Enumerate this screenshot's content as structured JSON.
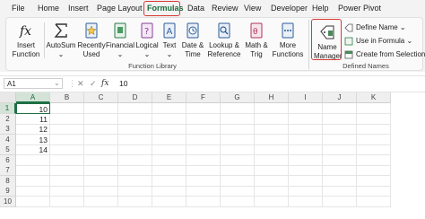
{
  "menu": {
    "tabs": [
      "File",
      "Home",
      "Insert",
      "Page Layout",
      "Formulas",
      "Data",
      "Review",
      "View",
      "Developer",
      "Help",
      "Power Pivot"
    ],
    "active_tab": "Formulas"
  },
  "ribbon": {
    "function_library": {
      "label": "Function Library",
      "buttons": [
        {
          "line1": "Insert",
          "line2": "Function",
          "icon": "fx-icon"
        },
        {
          "line1": "AutoSum",
          "line2": "",
          "icon": "sigma-icon"
        },
        {
          "line1": "Recently",
          "line2": "Used",
          "icon": "star-book-icon"
        },
        {
          "line1": "Financial",
          "line2": "",
          "icon": "financial-book-icon"
        },
        {
          "line1": "Logical",
          "line2": "",
          "icon": "question-book-icon"
        },
        {
          "line1": "Text",
          "line2": "",
          "icon": "text-book-icon"
        },
        {
          "line1": "Date &",
          "line2": "Time",
          "icon": "clock-book-icon"
        },
        {
          "line1": "Lookup &",
          "line2": "Reference",
          "icon": "lookup-book-icon"
        },
        {
          "line1": "Math &",
          "line2": "Trig",
          "icon": "math-book-icon"
        },
        {
          "line1": "More",
          "line2": "Functions",
          "icon": "more-book-icon"
        }
      ]
    },
    "defined_names": {
      "label": "Defined Names",
      "name_manager": {
        "line1": "Name",
        "line2": "Manager",
        "icon": "name-tag-icon"
      },
      "define_name": "Define Name",
      "use_in_formula": "Use in Formula",
      "create_from_selection": "Create from Selection"
    }
  },
  "formula_bar": {
    "name_box": "A1",
    "fx_label": "fx",
    "value": "10"
  },
  "sheet": {
    "columns": [
      "A",
      "B",
      "C",
      "D",
      "E",
      "F",
      "G",
      "H",
      "I",
      "J",
      "K"
    ],
    "rows": [
      "1",
      "2",
      "3",
      "4",
      "5",
      "6",
      "7",
      "8",
      "9",
      "10"
    ],
    "a_values": [
      "10",
      "11",
      "12",
      "13",
      "14"
    ]
  },
  "colors": {
    "accent": "#1e7145",
    "highlight": "#d63a32"
  }
}
